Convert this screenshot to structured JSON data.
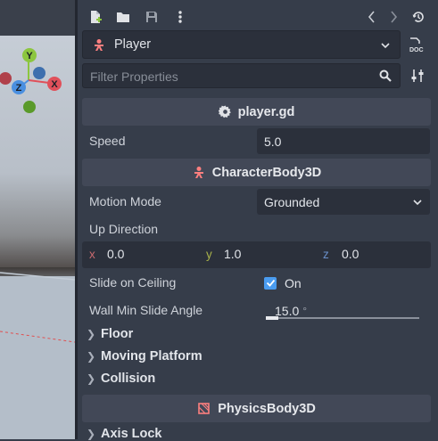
{
  "viewport": {
    "gizmo": {
      "y_label": "Y",
      "x_label": "X",
      "z_label": "Z"
    }
  },
  "toolbar": {
    "icons": [
      "new-script-icon",
      "open-icon",
      "save-icon",
      "more-icon",
      "history-back-icon",
      "history-forward-icon",
      "recent-history-icon"
    ]
  },
  "node": {
    "name": "Player",
    "icon": "character-body-icon"
  },
  "filter": {
    "placeholder": "Filter Properties"
  },
  "script_section": {
    "title": "player.gd"
  },
  "speed": {
    "label": "Speed",
    "value": "5.0"
  },
  "character_section": {
    "title": "CharacterBody3D"
  },
  "motion_mode": {
    "label": "Motion Mode",
    "value": "Grounded"
  },
  "up_direction": {
    "label": "Up Direction",
    "x_axis": "x",
    "x": "0.0",
    "y_axis": "y",
    "y": "1.0",
    "z_axis": "z",
    "z": "0.0"
  },
  "slide_on_ceiling": {
    "label": "Slide on Ceiling",
    "value": "On",
    "checked": true
  },
  "wall_min_slide_angle": {
    "label": "Wall Min Slide Angle",
    "value": "15.0",
    "unit": "°",
    "fraction": 0.08
  },
  "groups": {
    "floor": "Floor",
    "moving_platform": "Moving Platform",
    "collision": "Collision",
    "axis_lock": "Axis Lock"
  },
  "physics_section": {
    "title": "PhysicsBody3D"
  },
  "colors": {
    "axis_x": "#e0505a",
    "axis_y": "#8cc63f",
    "axis_z": "#4a8fe0",
    "accent": "#4a9cf0"
  }
}
